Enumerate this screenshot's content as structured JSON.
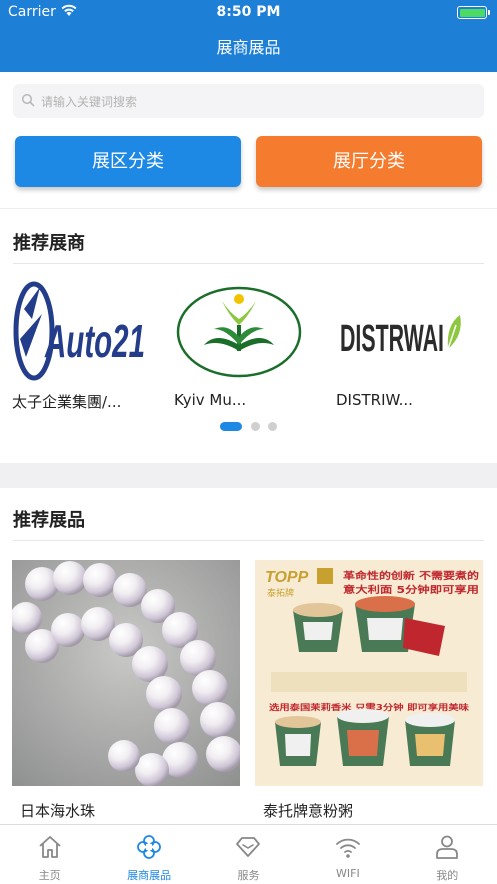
{
  "status_bar": {
    "carrier": "Carrier",
    "time": "8:50 PM"
  },
  "nav": {
    "title": "展商展品"
  },
  "search": {
    "placeholder": "请输入关键词搜索"
  },
  "categories": [
    {
      "label": "展区分类",
      "color": "#1e88e5"
    },
    {
      "label": "展厅分类",
      "color": "#f57c2e"
    }
  ],
  "recommended_exhibitors": {
    "title": "推荐展商",
    "items": [
      {
        "name": "太子企業集團/...",
        "logo_text": "Auto21"
      },
      {
        "name": "Kyiv Mu...",
        "logo_text": ""
      },
      {
        "name": "DISTRIW...",
        "logo_text": "DISTRWAI"
      }
    ],
    "page_count": 3,
    "active_page": 1
  },
  "recommended_products": {
    "title": "推荐展品",
    "items": [
      {
        "name": "日本海水珠"
      },
      {
        "name": "泰托牌意粉粥",
        "poster": {
          "brand": "TOPP",
          "brand_cn": "泰拓牌",
          "headline": "革命性的创新 不需要煮的",
          "subline": "意大利面 5分钟即可享用",
          "tagline": "选用泰国茉莉香米 只需3分钟 即可享用美味"
        }
      }
    ]
  },
  "tab_bar": {
    "items": [
      {
        "label": "主页",
        "icon": "home-icon"
      },
      {
        "label": "展商展品",
        "icon": "clover-icon",
        "active": true
      },
      {
        "label": "服务",
        "icon": "diamond-icon"
      },
      {
        "label": "WIFI",
        "icon": "wifi-icon"
      },
      {
        "label": "我的",
        "icon": "user-icon"
      }
    ]
  },
  "colors": {
    "primary": "#1e7fd6",
    "accent_blue": "#1e88e5",
    "accent_orange": "#f57c2e"
  }
}
